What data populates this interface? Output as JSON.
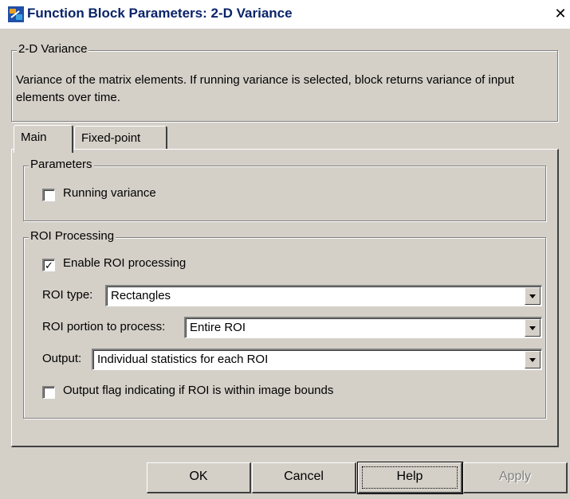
{
  "window": {
    "title": "Function Block Parameters: 2-D Variance",
    "close_icon": "close-icon"
  },
  "block": {
    "group_title": "2-D Variance",
    "description": "Variance of the matrix elements. If running variance is selected, block returns variance of input elements over time."
  },
  "tabs": [
    {
      "label": "Main",
      "selected": true
    },
    {
      "label": "Fixed-point",
      "selected": false
    }
  ],
  "parameters": {
    "group_title": "Parameters",
    "running_variance": {
      "label": "Running variance",
      "checked": false
    }
  },
  "roi": {
    "group_title": "ROI Processing",
    "enable": {
      "label": "Enable ROI processing",
      "checked": true,
      "mark": "✓"
    },
    "roi_type": {
      "label": "ROI type:",
      "value": "Rectangles"
    },
    "portion": {
      "label": "ROI portion to process:",
      "value": "Entire ROI"
    },
    "output": {
      "label": "Output:",
      "value": "Individual statistics for each ROI"
    },
    "flag": {
      "label": "Output flag indicating if ROI is within image bounds",
      "checked": false
    }
  },
  "buttons": {
    "ok": "OK",
    "cancel": "Cancel",
    "help": "Help",
    "apply": "Apply"
  },
  "colors": {
    "dialog_bg": "#d4d0c8",
    "title_text": "#0a246a",
    "disabled_text": "#808080"
  }
}
